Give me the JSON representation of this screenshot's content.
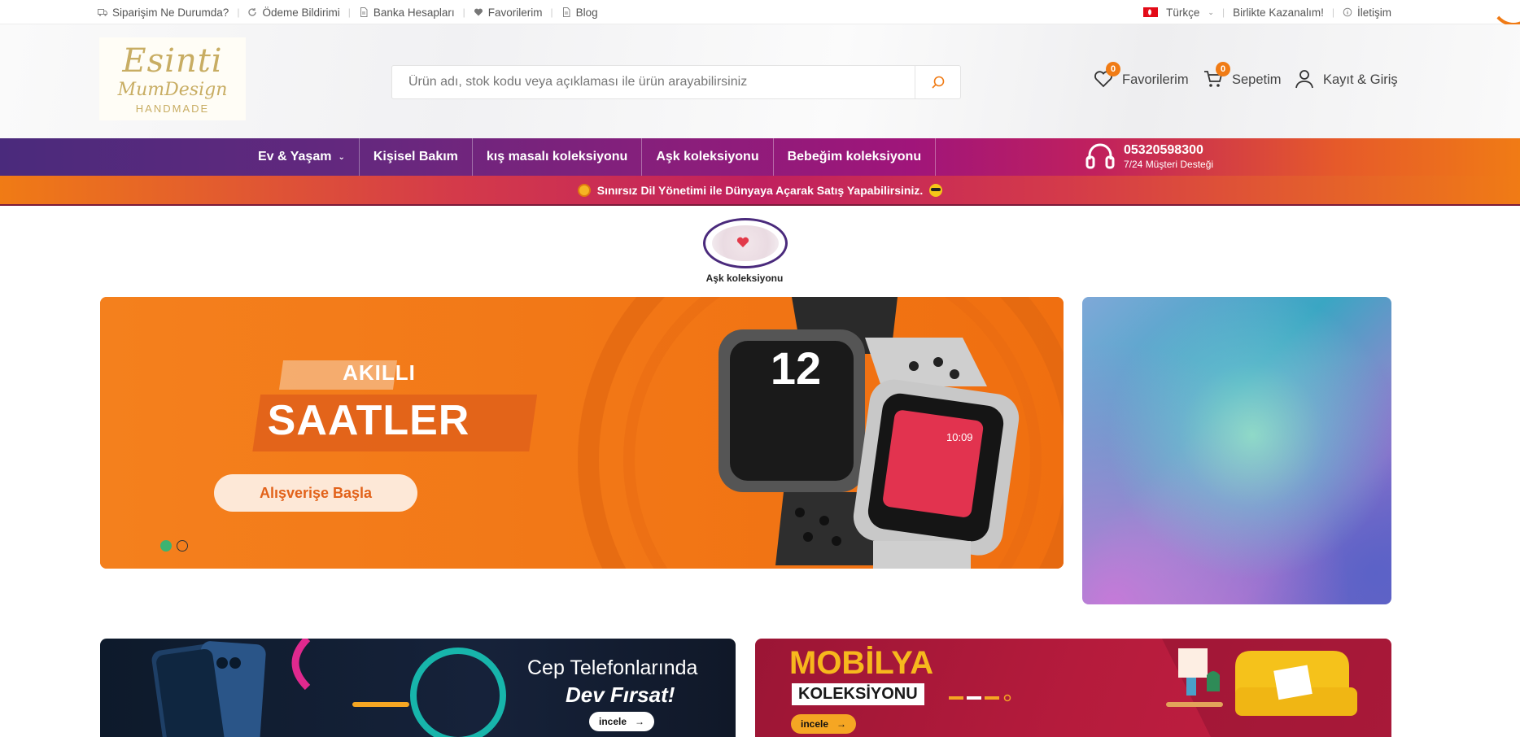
{
  "topbar": {
    "links": [
      {
        "label": "Siparişim Ne Durumda?",
        "icon": "truck-icon"
      },
      {
        "label": "Ödeme Bildirimi",
        "icon": "refresh-icon"
      },
      {
        "label": "Banka Hesapları",
        "icon": "document-icon"
      },
      {
        "label": "Favorilerim",
        "icon": "heart-icon"
      },
      {
        "label": "Blog",
        "icon": "document-icon"
      }
    ],
    "language": "Türkçe",
    "affiliate": "Birlikte Kazanalım!",
    "contact": "İletişim"
  },
  "header": {
    "logo": {
      "line1": "Esinti",
      "line2": "MumDesign",
      "line3": "HANDMADE"
    },
    "search_placeholder": "Ürün adı, stok kodu veya açıklaması ile ürün arayabilirsiniz",
    "favorites": {
      "label": "Favorilerim",
      "count": "0"
    },
    "cart": {
      "label": "Sepetim",
      "count": "0"
    },
    "account": {
      "label": "Kayıt & Giriş"
    }
  },
  "nav": {
    "items": [
      "Ev & Yaşam",
      "Kişisel Bakım",
      "kış masalı koleksiyonu",
      "Aşk koleksiyonu",
      "Bebeğim koleksiyonu"
    ],
    "support_phone": "05320598300",
    "support_text": "7/24 Müşteri Desteği"
  },
  "announcement": "Sınırsız Dil Yönetimi ile Dünyaya Açarak Satış Yapabilirsiniz.",
  "story": {
    "label": "Aşk koleksiyonu"
  },
  "slider": {
    "tag": "AKILLI",
    "title": "SAATLER",
    "cta": "Alışverişe Başla",
    "watch_time_1": "12",
    "watch_time_2": "10:09",
    "slides": 2,
    "active_slide": 1
  },
  "banners": [
    {
      "line1": "Cep Telefonlarında",
      "line2": "Dev Fırsat!",
      "cta": "incele"
    },
    {
      "line1": "MOBİLYA",
      "line2": "KOLEKSİYONU",
      "cta": "incele"
    }
  ],
  "colors": {
    "accent": "#f07b15",
    "purple": "#4a2a7c",
    "magenta": "#a0157a"
  }
}
